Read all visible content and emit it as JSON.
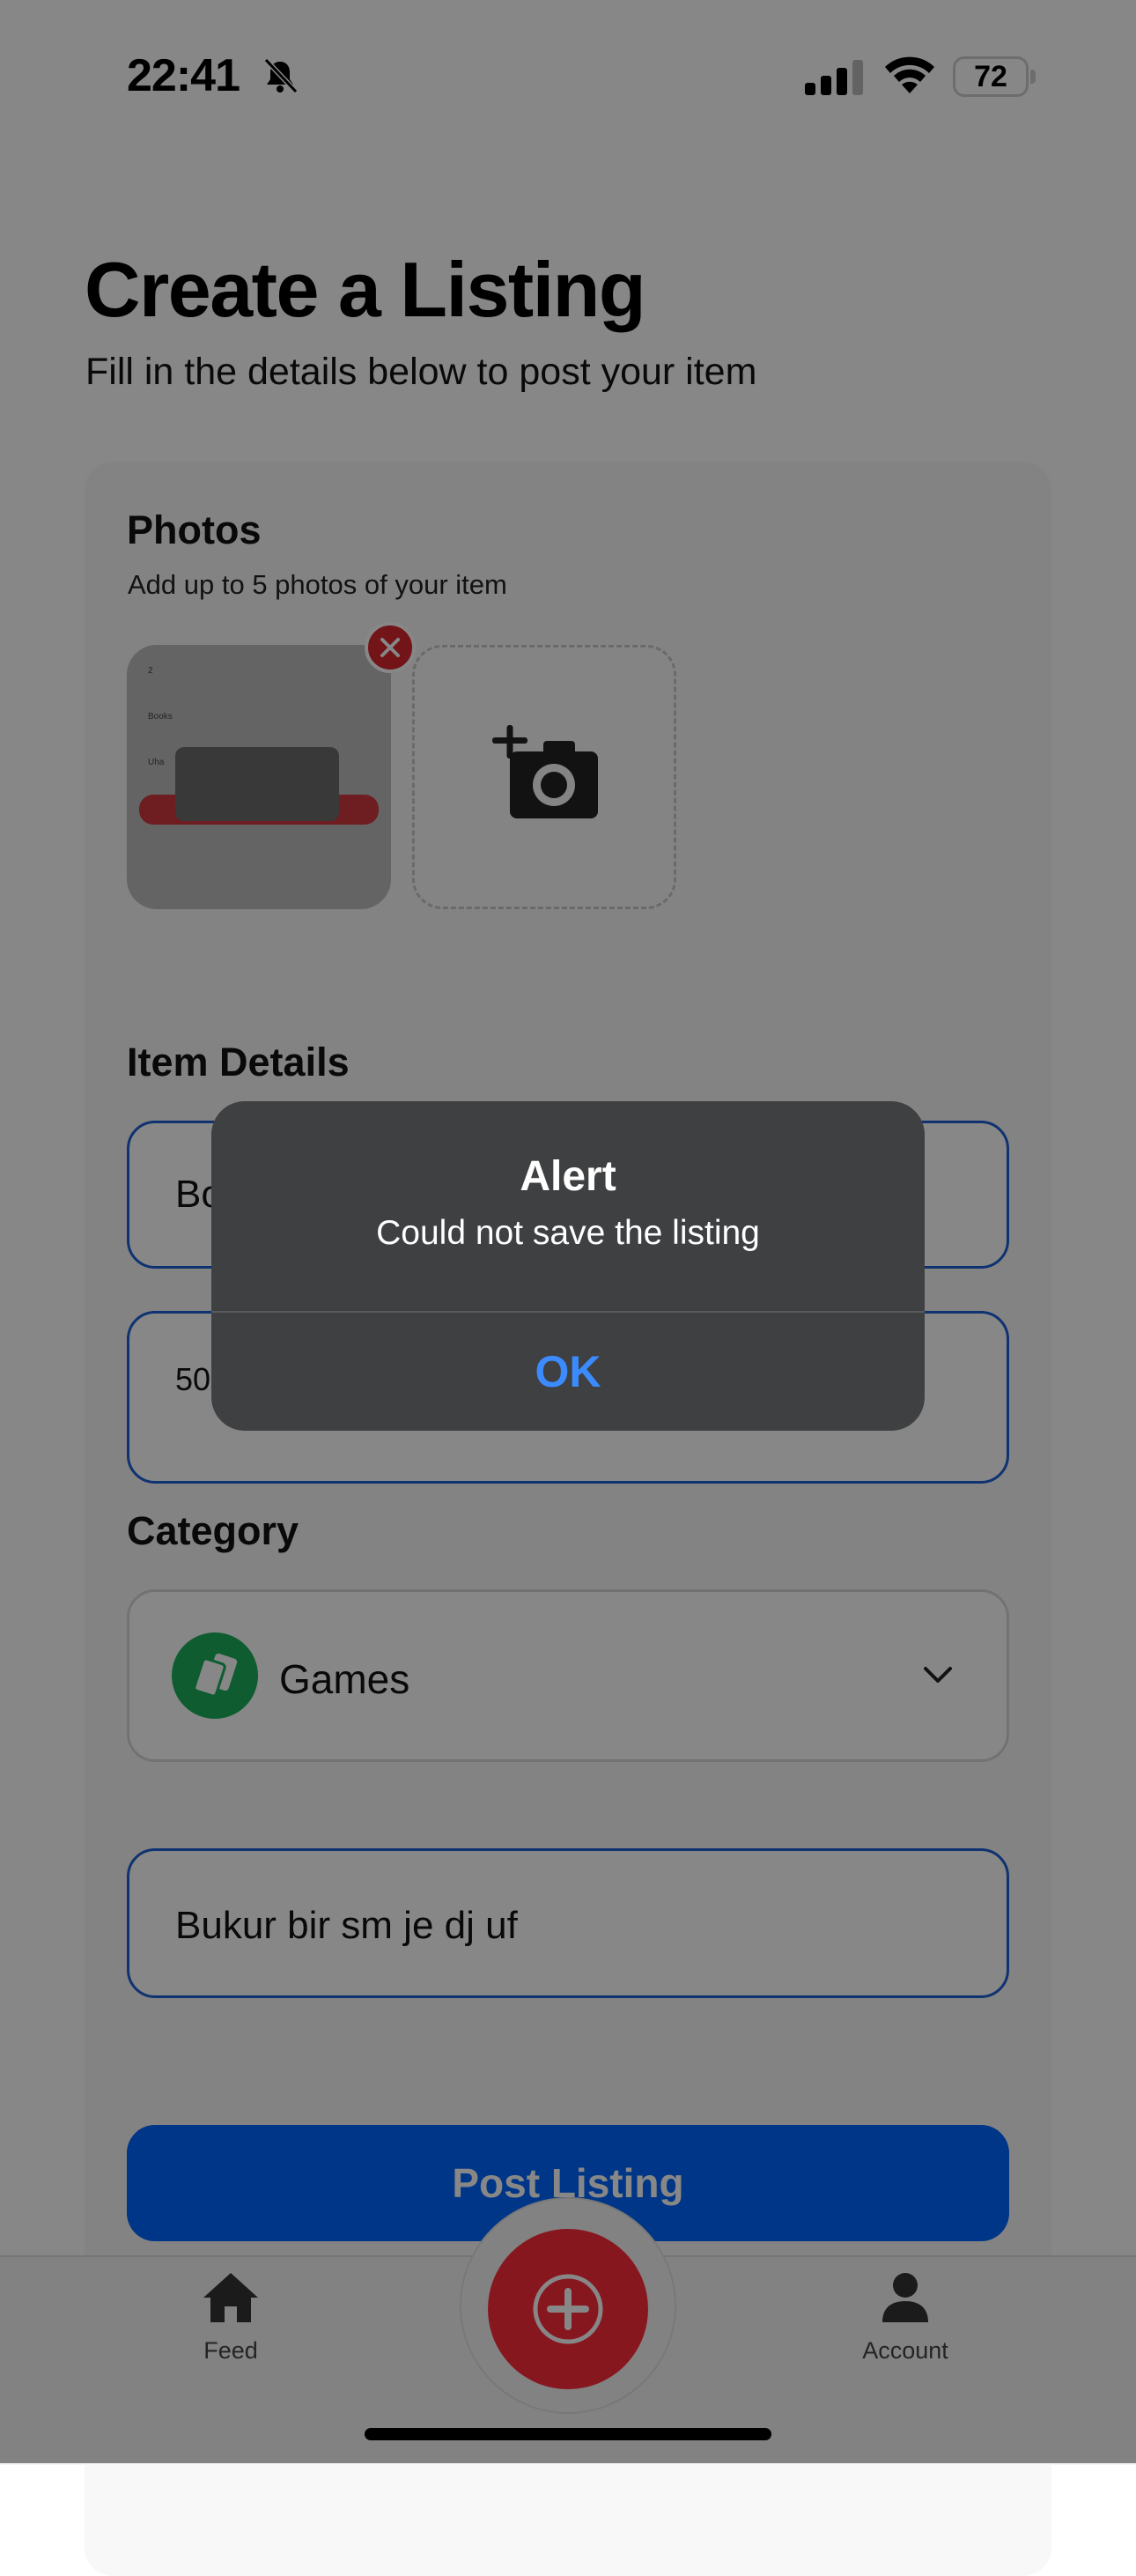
{
  "status_bar": {
    "time": "22:41",
    "battery": "72"
  },
  "header": {
    "title": "Create a Listing",
    "subtitle": "Fill in the details below to post your item"
  },
  "photos": {
    "heading": "Photos",
    "hint": "Add up to 5 photos of your item",
    "count": 1
  },
  "details": {
    "heading": "Item Details",
    "title_value": "Bo",
    "price_value": "50"
  },
  "category": {
    "heading": "Category",
    "selected": "Games",
    "icon": "cards-icon",
    "icon_color": "#1bae5b"
  },
  "description": {
    "value": "Bukur bir sm je dj uf"
  },
  "actions": {
    "post_label": "Post Listing",
    "post_color": "#0066ff"
  },
  "tabs": [
    {
      "label": "Feed",
      "icon": "home-icon"
    },
    {
      "label": "",
      "icon": "plus-icon",
      "color": "#ff2d3c"
    },
    {
      "label": "Account",
      "icon": "person-icon"
    }
  ],
  "alert": {
    "title": "Alert",
    "message": "Could not save the listing",
    "ok_label": "OK"
  }
}
